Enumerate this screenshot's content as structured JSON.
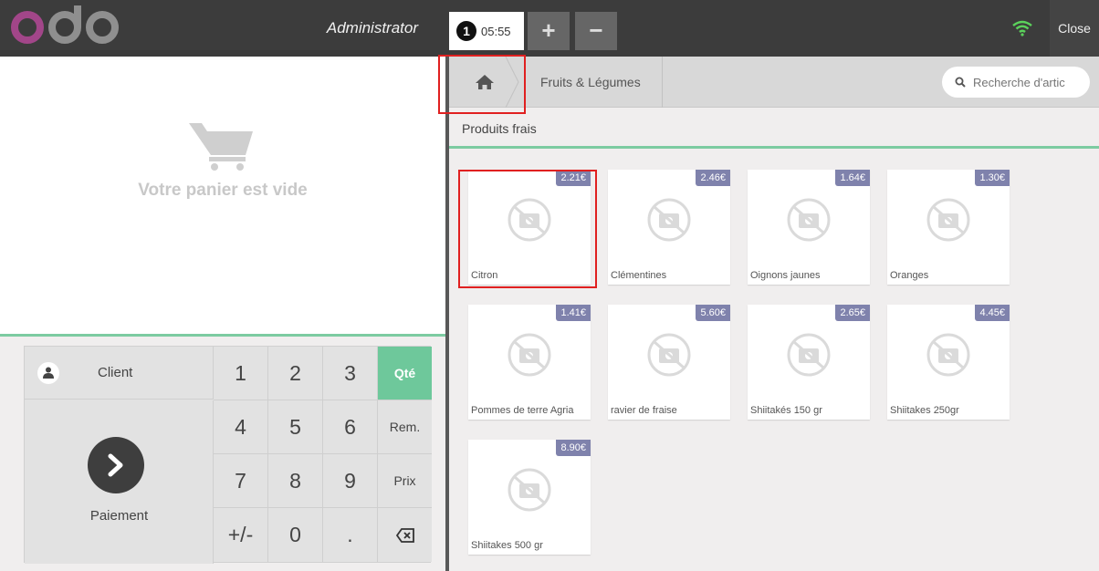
{
  "header": {
    "logo_text": "odoo",
    "cashier_name": "Administrator",
    "order": {
      "number": "1",
      "time": "05:55"
    },
    "add_order_label": "+",
    "remove_order_label": "−",
    "wifi_icon": "wifi-icon",
    "close_label": "Close"
  },
  "cart": {
    "empty_message": "Votre panier est vide",
    "icon": "shopping-cart-icon"
  },
  "numpad": {
    "client_label": "Client",
    "payment_label": "Paiement",
    "keys": [
      "1",
      "2",
      "3",
      "4",
      "5",
      "6",
      "7",
      "8",
      "9",
      "+/-",
      "0",
      "."
    ],
    "modes": {
      "qty": "Qté",
      "discount": "Rem.",
      "price": "Prix"
    },
    "backspace_icon": "backspace-icon"
  },
  "breadcrumb": {
    "home_icon": "home-icon",
    "category": "Fruits & Légumes"
  },
  "search": {
    "placeholder": "Recherche d'artic"
  },
  "category_title": "Produits frais",
  "products": [
    {
      "name": "Citron",
      "price": "2.21€"
    },
    {
      "name": "Clémentines",
      "price": "2.46€"
    },
    {
      "name": "Oignons jaunes",
      "price": "1.64€"
    },
    {
      "name": "Oranges",
      "price": "1.30€"
    },
    {
      "name": "Pommes de terre Agria",
      "price": "1.41€"
    },
    {
      "name": "ravier de fraise",
      "price": "5.60€"
    },
    {
      "name": "Shiitakés 150 gr",
      "price": "2.65€"
    },
    {
      "name": "Shiitakes 250gr",
      "price": "4.45€"
    },
    {
      "name": "Shiitakes 500 gr",
      "price": "8.90€"
    }
  ],
  "colors": {
    "header": "#3c3c3c",
    "accent_green": "#6ec89b",
    "price_tag": "#7f82ac",
    "wifi": "#5bd15b",
    "highlight": "#e02020"
  }
}
